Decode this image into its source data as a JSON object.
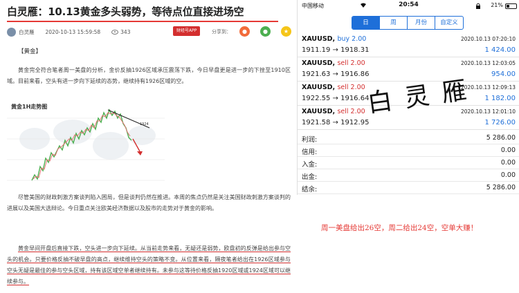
{
  "article": {
    "title": "白灵雁：10.13黄金多头弱势，等待点位直接进场空",
    "author": "白灵雁",
    "datetime": "2020-10-13 15:59:58",
    "views": "343",
    "app_button": "财经号APP",
    "share_label": "分享到：",
    "section_tag": "【黄金】",
    "para1": "黄金完全符合笔者周一美盘的分析，金价反抽1926区域承压震荡下跌，今日早盘更是进一步的下挫至1910区域。目前来看，空头有进一步向下延续的态势，继续持有1926区域的空。",
    "chart_title": "黄金1H走势图",
    "chart_label": "1924",
    "para2": "尽管美国的财政刺激方案谈判陷入困局，但是谈判仍然在推进。本周的焦点仍然是关注美国财政刺激方案谈判的进展以及美国大选辩论。今日重点关注欧美经济数据以及股市的走势对于黄金的影响。",
    "para3_a": "黄金早间开盘后直接下跌，空头进一步向下延续。从当前走势来看，无疑还是弱势，欧盘初的反弹是给出参与空头的机会。只要价格反抽不破早盘的高点，继续维持空头的策略不变。从位置来看，隔夜笔者给出在1926区域参与空头无疑是最佳的参与空头区域，持有该区域空单者继续持有。未参与这等待价格反抽1920区域或1924区域可以继续参与。"
  },
  "phone": {
    "status": {
      "carrier": "中国移动",
      "time": "20:54",
      "battery": "21%"
    },
    "tabs": [
      {
        "label": "日",
        "active": true
      },
      {
        "label": "周",
        "active": false
      },
      {
        "label": "月份",
        "active": false
      },
      {
        "label": "自定义",
        "active": false
      }
    ],
    "trades": [
      {
        "symbol": "XAUUSD,",
        "side": "buy 2.00",
        "side_type": "buy",
        "date": "2020.10.13 07:20:10",
        "prices": "1911.19 → 1918.31",
        "profit": "1 424.00"
      },
      {
        "symbol": "XAUUSD,",
        "side": "sell 2.00",
        "side_type": "sell",
        "date": "2020.10.13 12:03:05",
        "prices": "1921.63 → 1916.86",
        "profit": "954.00"
      },
      {
        "symbol": "XAUUSD,",
        "side": "sell 2.00",
        "side_type": "sell",
        "date": "2020.10.13 12:09:13",
        "prices": "1922.55 → 1916.64",
        "profit": "1 182.00"
      },
      {
        "symbol": "XAUUSD,",
        "side": "sell 2.00",
        "side_type": "sell",
        "date": "2020.10.13 12:01:10",
        "prices": "1921.58 → 1912.95",
        "profit": "1 726.00"
      }
    ],
    "summary": [
      {
        "label": "利润:",
        "value": "5 286.00"
      },
      {
        "label": "信用:",
        "value": "0.00"
      },
      {
        "label": "入金:",
        "value": "0.00"
      },
      {
        "label": "出金:",
        "value": "0.00"
      },
      {
        "label": "结余:",
        "value": "5 286.00"
      }
    ]
  },
  "watermark": "白灵雁",
  "caption": "周一美盘给出26空，周二给出24空，空单大赚！",
  "colors": {
    "accent_blue": "#1e6fd9",
    "sell_red": "#d32f2f",
    "title_underline": "#e53935"
  }
}
